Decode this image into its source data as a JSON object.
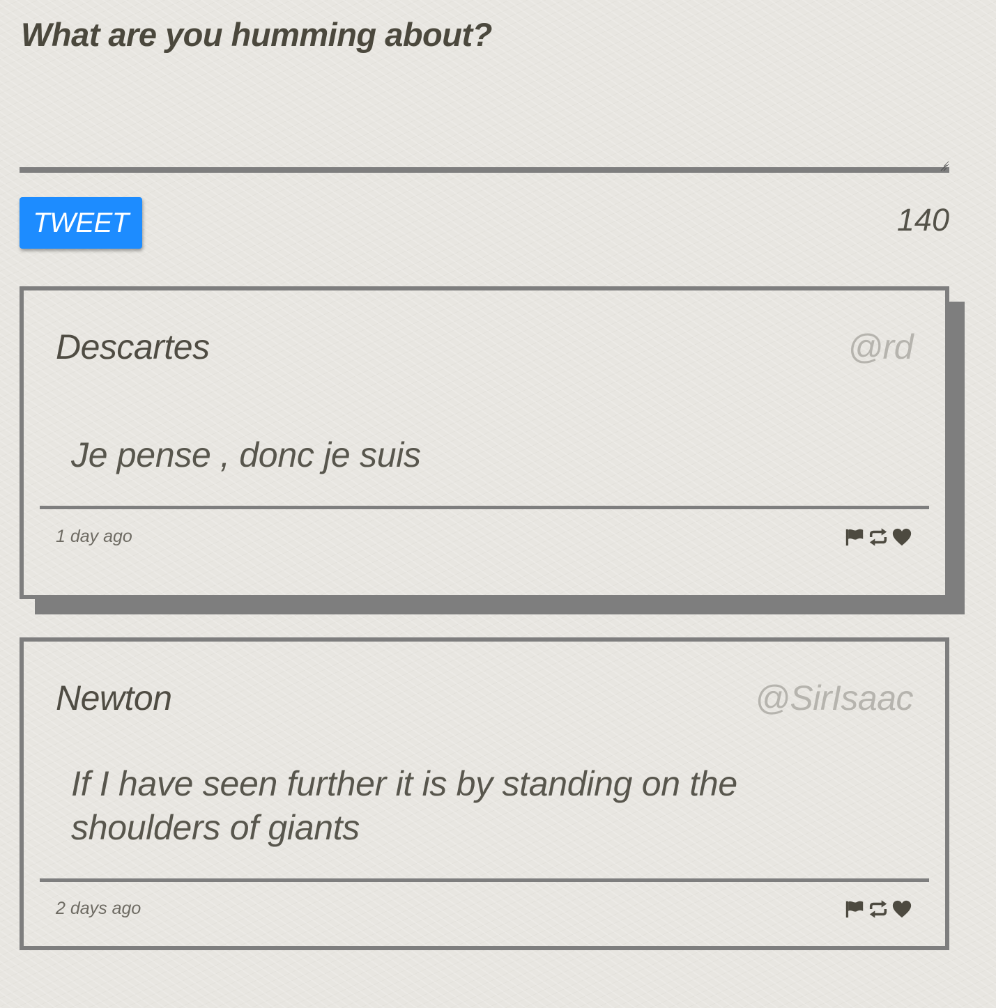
{
  "compose": {
    "heading": "What are you humming about?",
    "textarea_value": "",
    "tweet_button_label": "TWEET",
    "char_counter": "140"
  },
  "tweets": [
    {
      "name": "Descartes",
      "handle": "@rd",
      "body": "Je pense , donc je suis",
      "timestamp": "1 day ago",
      "actions": [
        "flag-icon",
        "retweet-icon",
        "heart-icon"
      ]
    },
    {
      "name": "Newton",
      "handle": "@SirIsaac",
      "body": "If I have seen further it is by standing on the shoulders of giants",
      "timestamp": "2 days ago",
      "actions": [
        "flag-icon",
        "retweet-icon",
        "heart-icon"
      ]
    }
  ],
  "colors": {
    "accent": "#1d8cff",
    "border": "#7e7e7e",
    "text": "#4d4a40",
    "handle": "#b6b4ae",
    "background": "#e8e6e1"
  }
}
